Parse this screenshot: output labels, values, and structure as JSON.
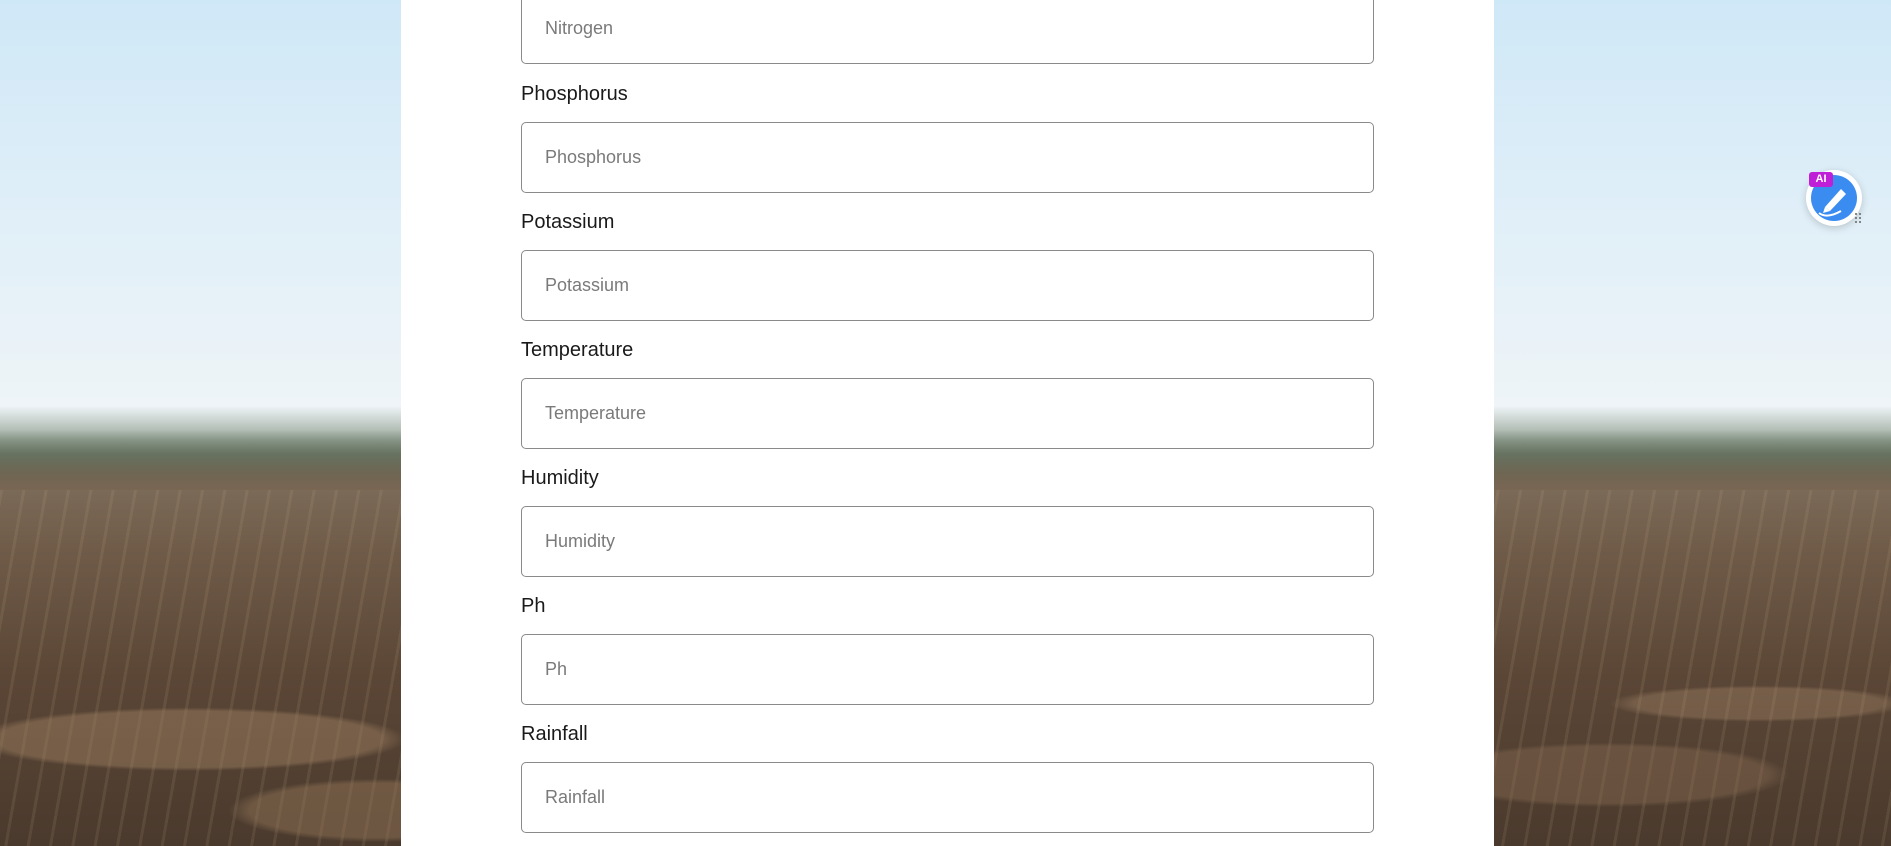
{
  "form": {
    "fields": [
      {
        "label": "",
        "placeholder": "Nitrogen",
        "value": ""
      },
      {
        "label": "Phosphorus",
        "placeholder": "Phosphorus",
        "value": ""
      },
      {
        "label": "Potassium",
        "placeholder": "Potassium",
        "value": ""
      },
      {
        "label": "Temperature",
        "placeholder": "Temperature",
        "value": ""
      },
      {
        "label": "Humidity",
        "placeholder": "Humidity",
        "value": ""
      },
      {
        "label": "Ph",
        "placeholder": "Ph",
        "value": ""
      },
      {
        "label": "Rainfall",
        "placeholder": "Rainfall",
        "value": ""
      }
    ]
  },
  "widget": {
    "badge": "AI",
    "icon": "pen-icon",
    "handle_icon": "drag-grip-icon",
    "colors": {
      "circle": "#3b8cf0",
      "badge": "#c01fd8"
    }
  }
}
